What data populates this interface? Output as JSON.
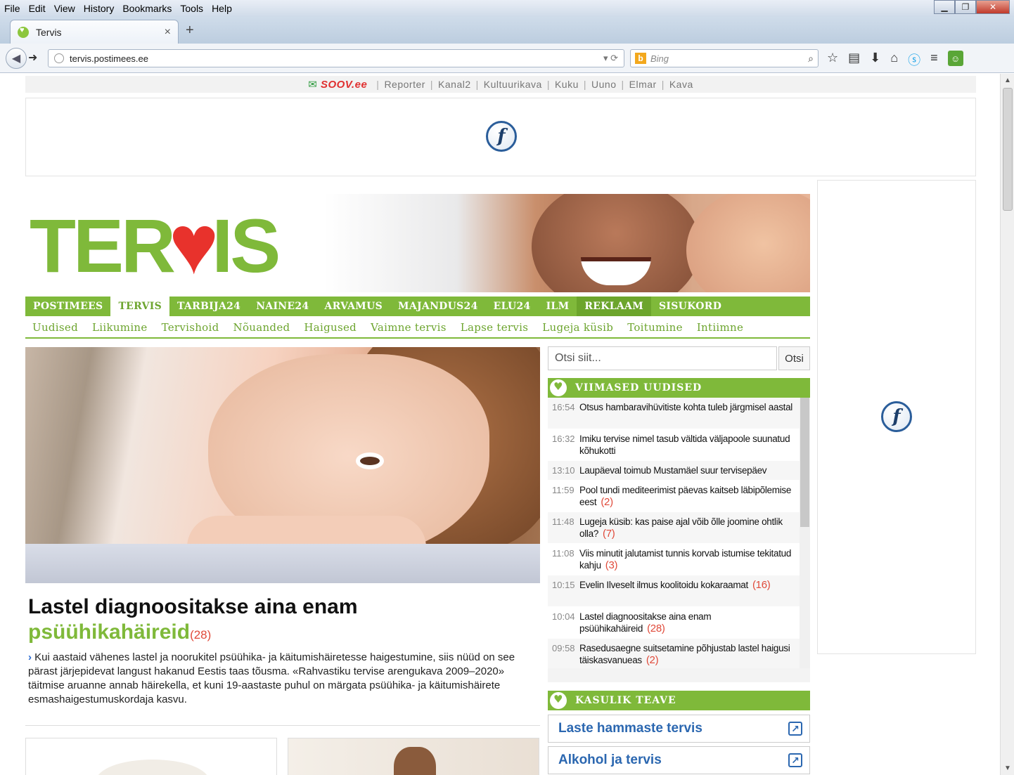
{
  "menubar": {
    "items": [
      "File",
      "Edit",
      "View",
      "History",
      "Bookmarks",
      "Tools",
      "Help"
    ]
  },
  "tab": {
    "title": "Tervis"
  },
  "urlbar": {
    "url": "tervis.postimees.ee"
  },
  "searchbar": {
    "placeholder": "Bing"
  },
  "toplinks": {
    "brand": "SOOV.ee",
    "items": [
      "Reporter",
      "Kanal2",
      "Kultuurikava",
      "Kuku",
      "Uuno",
      "Elmar",
      "Kava"
    ]
  },
  "logo": {
    "left": "TER",
    "right": "IS"
  },
  "mainnav": {
    "items": [
      "POSTIMEES",
      "TERVIS",
      "TARBIJA24",
      "NAINE24",
      "ARVAMUS",
      "MAJANDUS24",
      "ELU24",
      "ILM",
      "REKLAAM",
      "SISUKORD"
    ],
    "active": "TERVIS",
    "accent": "#7fb93a"
  },
  "subnav": {
    "items": [
      "Uudised",
      "Liikumine",
      "Tervishoid",
      "Nõuanded",
      "Haigused",
      "Vaimne tervis",
      "Lapse tervis",
      "Lugeja küsib",
      "Toitumine",
      "Intiimne"
    ]
  },
  "article": {
    "title_line1": "Lastel diagnoositakse aina enam",
    "title_line2": "psüühikahäireid",
    "comment_count": "(28)",
    "lead": "Kui aastaid vähenes lastel ja noorukitel psüühika- ja käitumishäiretesse haigestumine, siis nüüd on see pärast järjepidevat langust hakanud Eestis taas tõusma. «Rahvastiku tervise arengukava 2009–2020» täitmise aruanne annab häirekella, et kuni 19-aastaste puhul on märgata psüühika- ja käitumishäirete esmashaigestumuskordaja kasvu."
  },
  "search": {
    "placeholder": "Otsi siit...",
    "button": "Otsi"
  },
  "latest": {
    "heading": "VIIMASED UUDISED",
    "items": [
      {
        "time": "16:54",
        "text": "Otsus hambaravihüvitiste kohta tuleb järgmisel aastal",
        "count": ""
      },
      {
        "time": "16:32",
        "text": "Imiku tervise nimel tasub vältida väljapoole suunatud kõhukotti",
        "count": ""
      },
      {
        "time": "13:10",
        "text": "Laupäeval toimub Mustamäel suur tervisepäev",
        "count": ""
      },
      {
        "time": "11:59",
        "text": "Pool tundi mediteerimist päevas kaitseb läbipõlemise eest",
        "count": "(2)"
      },
      {
        "time": "11:48",
        "text": "Lugeja küsib: kas paise ajal võib õlle joomine ohtlik olla?",
        "count": "(7)"
      },
      {
        "time": "11:08",
        "text": "Viis minutit jalutamist tunnis korvab istumise tekitatud kahju",
        "count": "(3)"
      },
      {
        "time": "10:15",
        "text": "Evelin Ilveselt ilmus koolitoidu kokaraamat",
        "count": "(16)"
      },
      {
        "time": "10:04",
        "text": "Lastel diagnoositakse aina enam psüühikahäireid",
        "count": "(28)"
      },
      {
        "time": "09:58",
        "text": "Rasedusaegne suitsetamine põhjustab lastel haigusi täiskasvanueas",
        "count": "(2)"
      }
    ]
  },
  "useful": {
    "heading": "KASULIK TEAVE",
    "links": [
      "Laste hammaste tervis",
      "Alkohol ja tervis"
    ]
  }
}
